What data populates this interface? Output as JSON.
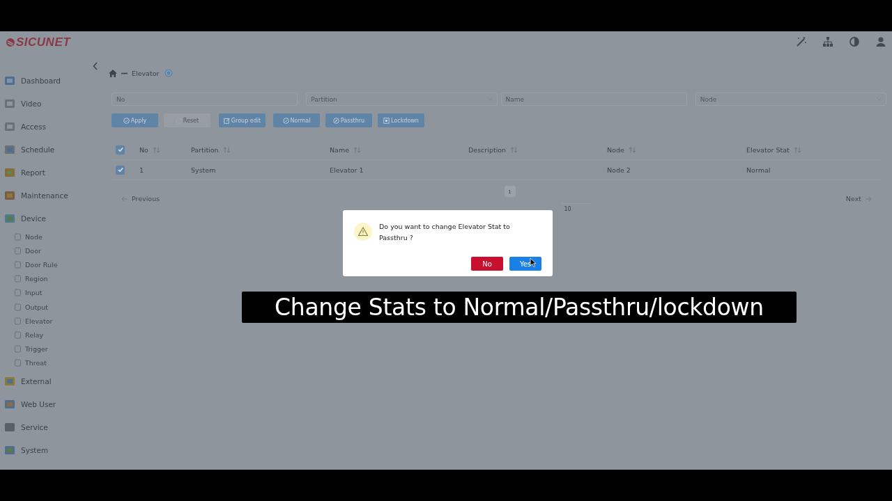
{
  "header": {
    "logo": "SICUNET"
  },
  "sidebar": {
    "items": [
      {
        "label": "Dashboard"
      },
      {
        "label": "Video"
      },
      {
        "label": "Access"
      },
      {
        "label": "Schedule"
      },
      {
        "label": "Report"
      },
      {
        "label": "Maintenance"
      },
      {
        "label": "Device",
        "children": [
          {
            "label": "Node"
          },
          {
            "label": "Door"
          },
          {
            "label": "Door Rule"
          },
          {
            "label": "Region"
          },
          {
            "label": "Input"
          },
          {
            "label": "Output"
          },
          {
            "label": "Elevator"
          },
          {
            "label": "Relay"
          },
          {
            "label": "Trigger"
          },
          {
            "label": "Threat"
          }
        ]
      },
      {
        "label": "External"
      },
      {
        "label": "Web User"
      },
      {
        "label": "Service"
      },
      {
        "label": "System"
      }
    ]
  },
  "breadcrumb": {
    "current": "Elevator"
  },
  "filters": [
    {
      "placeholder": "No",
      "kind": "text"
    },
    {
      "placeholder": "Partition",
      "kind": "select"
    },
    {
      "placeholder": "Name",
      "kind": "text"
    },
    {
      "placeholder": "Node",
      "kind": "select"
    }
  ],
  "buttons": [
    {
      "label": "Apply",
      "disabled": false
    },
    {
      "label": "Reset",
      "disabled": true
    },
    {
      "label": "Group edit",
      "disabled": false
    },
    {
      "label": "Normal",
      "disabled": false
    },
    {
      "label": "Passthru",
      "disabled": false
    },
    {
      "label": "Lockdown",
      "disabled": false
    }
  ],
  "table": {
    "all_checked": true,
    "columns": [
      "No",
      "Partition",
      "Name",
      "Description",
      "Node",
      "Elevator Stat"
    ],
    "rows": [
      {
        "checked": true,
        "cells": [
          "1",
          "System",
          "Elevator 1",
          "",
          "Node 2",
          "Normal"
        ]
      }
    ]
  },
  "pagination": {
    "previous": "Previous",
    "page": "1",
    "rows_per_page": "10",
    "next": "Next"
  },
  "dialog": {
    "message": "Do you want to change Elevator Stat to Passthru ?",
    "buttons": [
      {
        "label": "No",
        "kind": "danger"
      },
      {
        "label": "Yes",
        "kind": "primary"
      }
    ]
  },
  "caption": "Change Stats to Normal/Passthru/lockdown"
}
